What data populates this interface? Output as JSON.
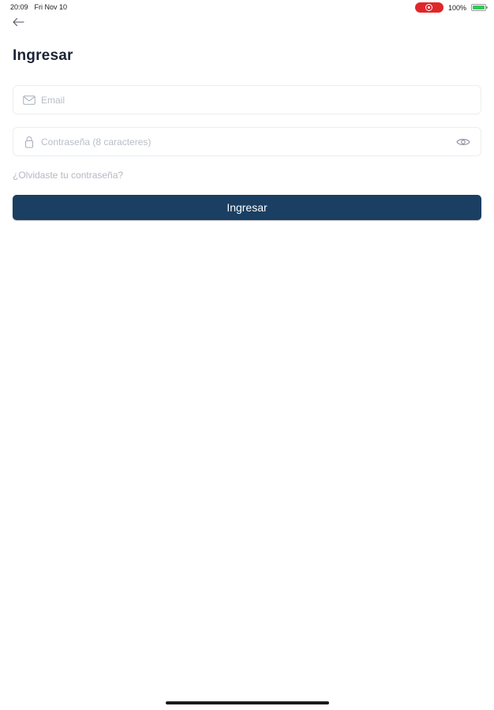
{
  "status_bar": {
    "time": "20:09",
    "date": "Fri Nov 10",
    "battery_percent": "100%",
    "battery_level": 1.0,
    "recording_color": "#e0262a",
    "battery_color": "#35c759"
  },
  "header": {
    "back_icon": "arrow-left-icon",
    "title": "Ingresar"
  },
  "form": {
    "email": {
      "icon": "mail-icon",
      "value": "",
      "placeholder": "Email"
    },
    "password": {
      "icon": "lock-icon",
      "value": "",
      "placeholder": "Contraseña (8 caracteres)",
      "toggle_icon": "eye-icon"
    },
    "forgot_password": "¿Olvidaste tu contraseña?",
    "submit_label": "Ingresar"
  },
  "colors": {
    "primary": "#1a3f63",
    "title_text": "#1b2435",
    "muted_text": "#b3b9c3",
    "border": "#eaedf2"
  }
}
